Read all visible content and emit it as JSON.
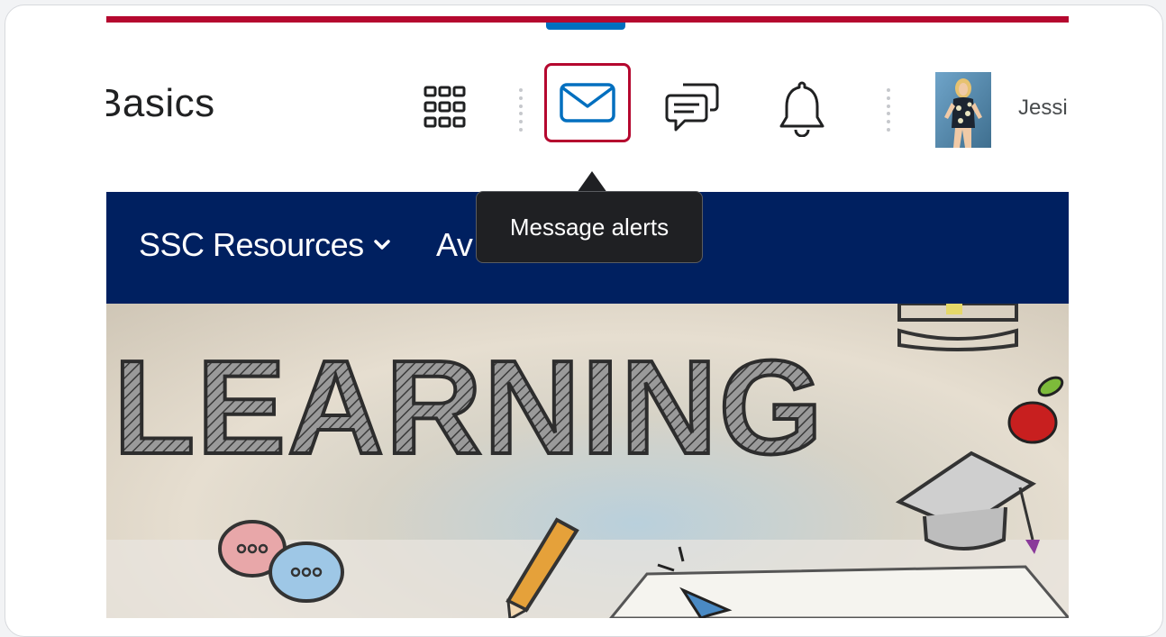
{
  "header": {
    "course_title": "Basics",
    "user_name": "Jessi"
  },
  "icons": {
    "apps": "waffle-grid-icon",
    "mail": "envelope-icon",
    "chat": "chat-bubbles-icon",
    "bell": "bell-icon"
  },
  "tooltip": {
    "text": "Message alerts"
  },
  "nav": {
    "items": [
      {
        "label": "SSC Resources"
      },
      {
        "label": "Av"
      }
    ]
  },
  "banner": {
    "word": "LEARNING"
  },
  "colors": {
    "brand_red": "#b5082f",
    "nav_blue": "#002060",
    "accent_blue": "#006fbf",
    "tooltip_bg": "#1f2023"
  }
}
